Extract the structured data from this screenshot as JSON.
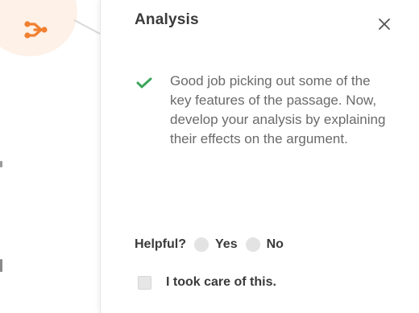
{
  "card": {
    "title": "Analysis",
    "message": "Good job picking out some of the key features of the passage. Now, develop your analysis by explaining their effects on the argument."
  },
  "feedback": {
    "helpful_label": "Helpful?",
    "yes_label": "Yes",
    "no_label": "No",
    "took_care_label": "I took care of this."
  },
  "icons": {
    "analysis": "share-nodes-icon",
    "close": "close-icon",
    "check": "check-icon"
  },
  "colors": {
    "accent_orange": "#f08030",
    "bubble_bg": "#fdf1e8",
    "check_green": "#3aa55a",
    "title_text": "#3a3a3a",
    "body_text": "#6a6a6a"
  }
}
